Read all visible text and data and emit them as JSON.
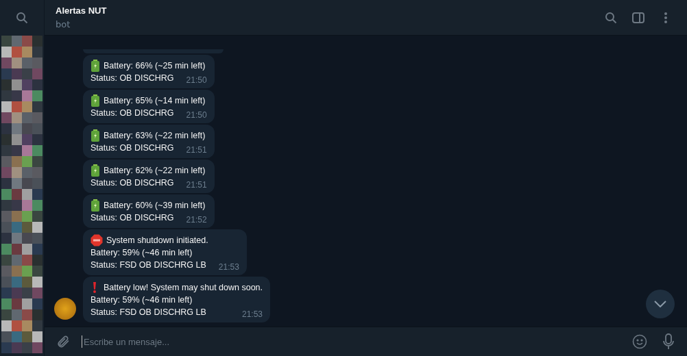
{
  "chat": {
    "title": "Alertas NUT",
    "subtitle": "bot"
  },
  "messages": [
    {
      "kind": "battery",
      "lines": [
        "Battery: 66% (~25 min left)",
        "Status: OB DISCHRG"
      ],
      "time": "21:50"
    },
    {
      "kind": "battery",
      "lines": [
        "Battery: 65% (~14 min left)",
        "Status: OB DISCHRG"
      ],
      "time": "21:50"
    },
    {
      "kind": "battery",
      "lines": [
        "Battery: 63% (~22 min left)",
        "Status: OB DISCHRG"
      ],
      "time": "21:51"
    },
    {
      "kind": "battery",
      "lines": [
        "Battery: 62% (~22 min left)",
        "Status: OB DISCHRG"
      ],
      "time": "21:51"
    },
    {
      "kind": "battery",
      "lines": [
        "Battery: 60% (~39 min left)",
        "Status: OB DISCHRG"
      ],
      "time": "21:52"
    },
    {
      "kind": "stop",
      "lines": [
        "System shutdown initiated.",
        "Battery: 59% (~46 min left)",
        "Status: FSD OB DISCHRG LB"
      ],
      "time": "21:53"
    },
    {
      "kind": "alert",
      "lines": [
        "Battery low! System may shut down soon.",
        "Battery: 59% (~46 min left)",
        "Status: FSD OB DISCHRG LB"
      ],
      "time": "21:53"
    }
  ],
  "composer": {
    "placeholder": "Escribe un mensaje..."
  }
}
